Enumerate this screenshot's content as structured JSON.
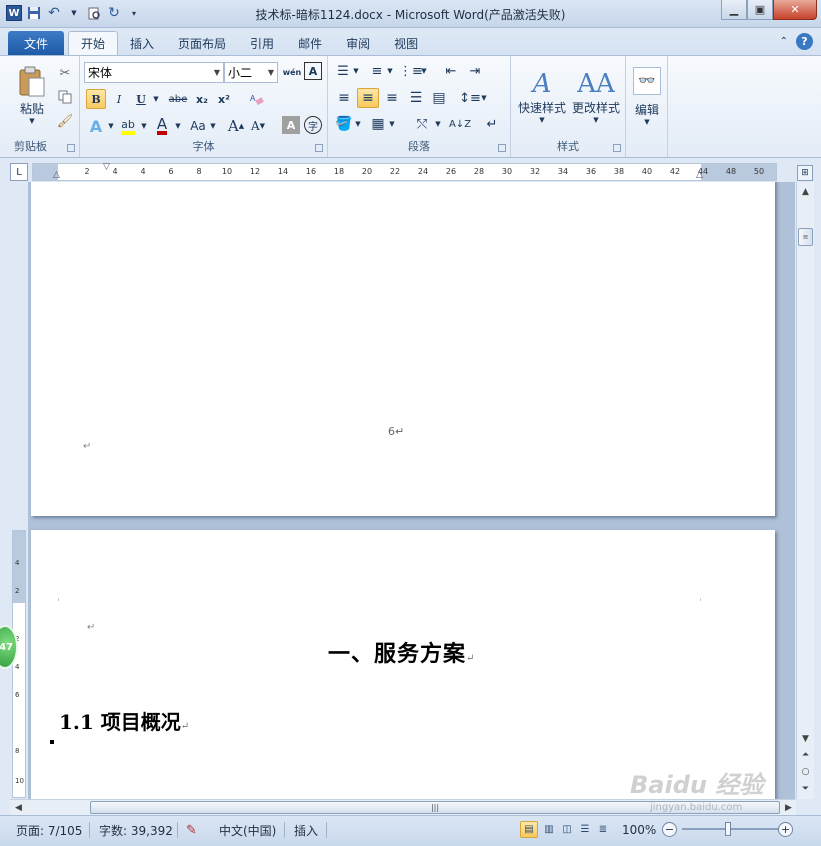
{
  "window": {
    "title": "技术标-暗标1124.docx - Microsoft Word(产品激活失败)",
    "logo": "W"
  },
  "tabs": {
    "file": "文件",
    "items": [
      "开始",
      "插入",
      "页面布局",
      "引用",
      "邮件",
      "审阅",
      "视图"
    ],
    "active": "开始"
  },
  "ribbon": {
    "clipboard": {
      "paste_label": "粘贴",
      "group_label": "剪贴板"
    },
    "font": {
      "group_label": "字体",
      "font_name": "宋体",
      "font_size": "小二",
      "bold": "B",
      "italic": "I",
      "underline": "U",
      "strike": "abe",
      "subscript": "x₂",
      "superscript": "x²",
      "grow": "A",
      "shrink": "A",
      "change_case": "Aa",
      "phonetic": "wén",
      "char_border": "A",
      "enclose": "字",
      "char_shading": "A"
    },
    "paragraph": {
      "group_label": "段落"
    },
    "styles": {
      "group_label": "样式",
      "quick_styles": "快速样式",
      "change_styles": "更改样式"
    },
    "editing": {
      "label": "编辑"
    }
  },
  "ruler": {
    "corner": "L",
    "ticks": [
      "2",
      "4",
      "2",
      "4",
      "6",
      "8",
      "10",
      "12",
      "14",
      "16",
      "18",
      "20",
      "22",
      "24",
      "26",
      "28",
      "30",
      "32",
      "34",
      "36",
      "38",
      "40",
      "42",
      "44",
      "48",
      "50"
    ],
    "vticks": [
      "4",
      "2",
      "2",
      "4",
      "6",
      "8",
      "10"
    ]
  },
  "document": {
    "prev_page_number": "6",
    "heading1": "一、服务方案",
    "heading2": "1.1 项目概况",
    "return_mark": "↵"
  },
  "statusbar": {
    "page": "页面: 7/105",
    "words": "字数: 39,392",
    "language": "中文(中国)",
    "mode": "插入",
    "zoom": "100%"
  },
  "side_badge": "47",
  "watermark": {
    "brand": "Baidu 经验",
    "url": "jingyan.baidu.com"
  }
}
